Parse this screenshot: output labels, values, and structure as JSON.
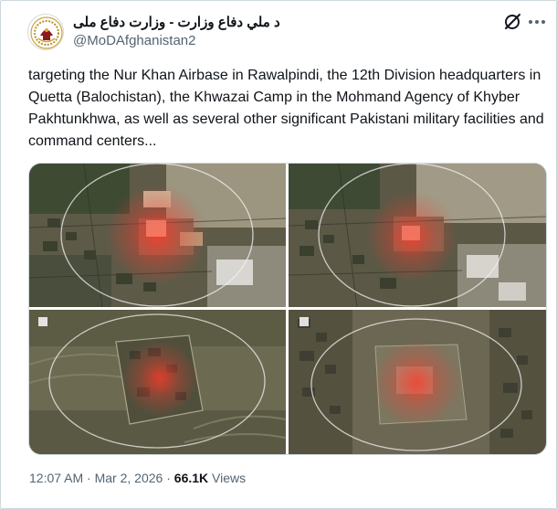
{
  "tweet": {
    "display_name": "د ملي دفاع وزارت - وزارت دفاع ملی",
    "handle": "@MoDAfghanistan2",
    "text": "targeting the Nur Khan Airbase in Rawalpindi, the 12th Division headquarters in Quetta (Balochistan), the Khwazai Camp in the Mohmand Agency of Khyber Pakhtunkhwa, as well as several other significant Pakistani military facilities and command centers...",
    "time": "12:07 AM",
    "separator": "·",
    "date": "Mar 2, 2026",
    "views_count": "66.1K",
    "views_label": "Views"
  },
  "icons": {
    "grok": "grok-icon",
    "more": "more-options-icon"
  },
  "colors": {
    "text": "#0f1419",
    "secondary_text": "#536471",
    "border": "#cfd9de",
    "strike_glow": "#ff3a2a"
  },
  "media": {
    "images": [
      {
        "alt": "satellite image with strike marker"
      },
      {
        "alt": "satellite image with strike marker"
      },
      {
        "alt": "satellite image with strike marker"
      },
      {
        "alt": "satellite image with strike marker"
      }
    ]
  }
}
